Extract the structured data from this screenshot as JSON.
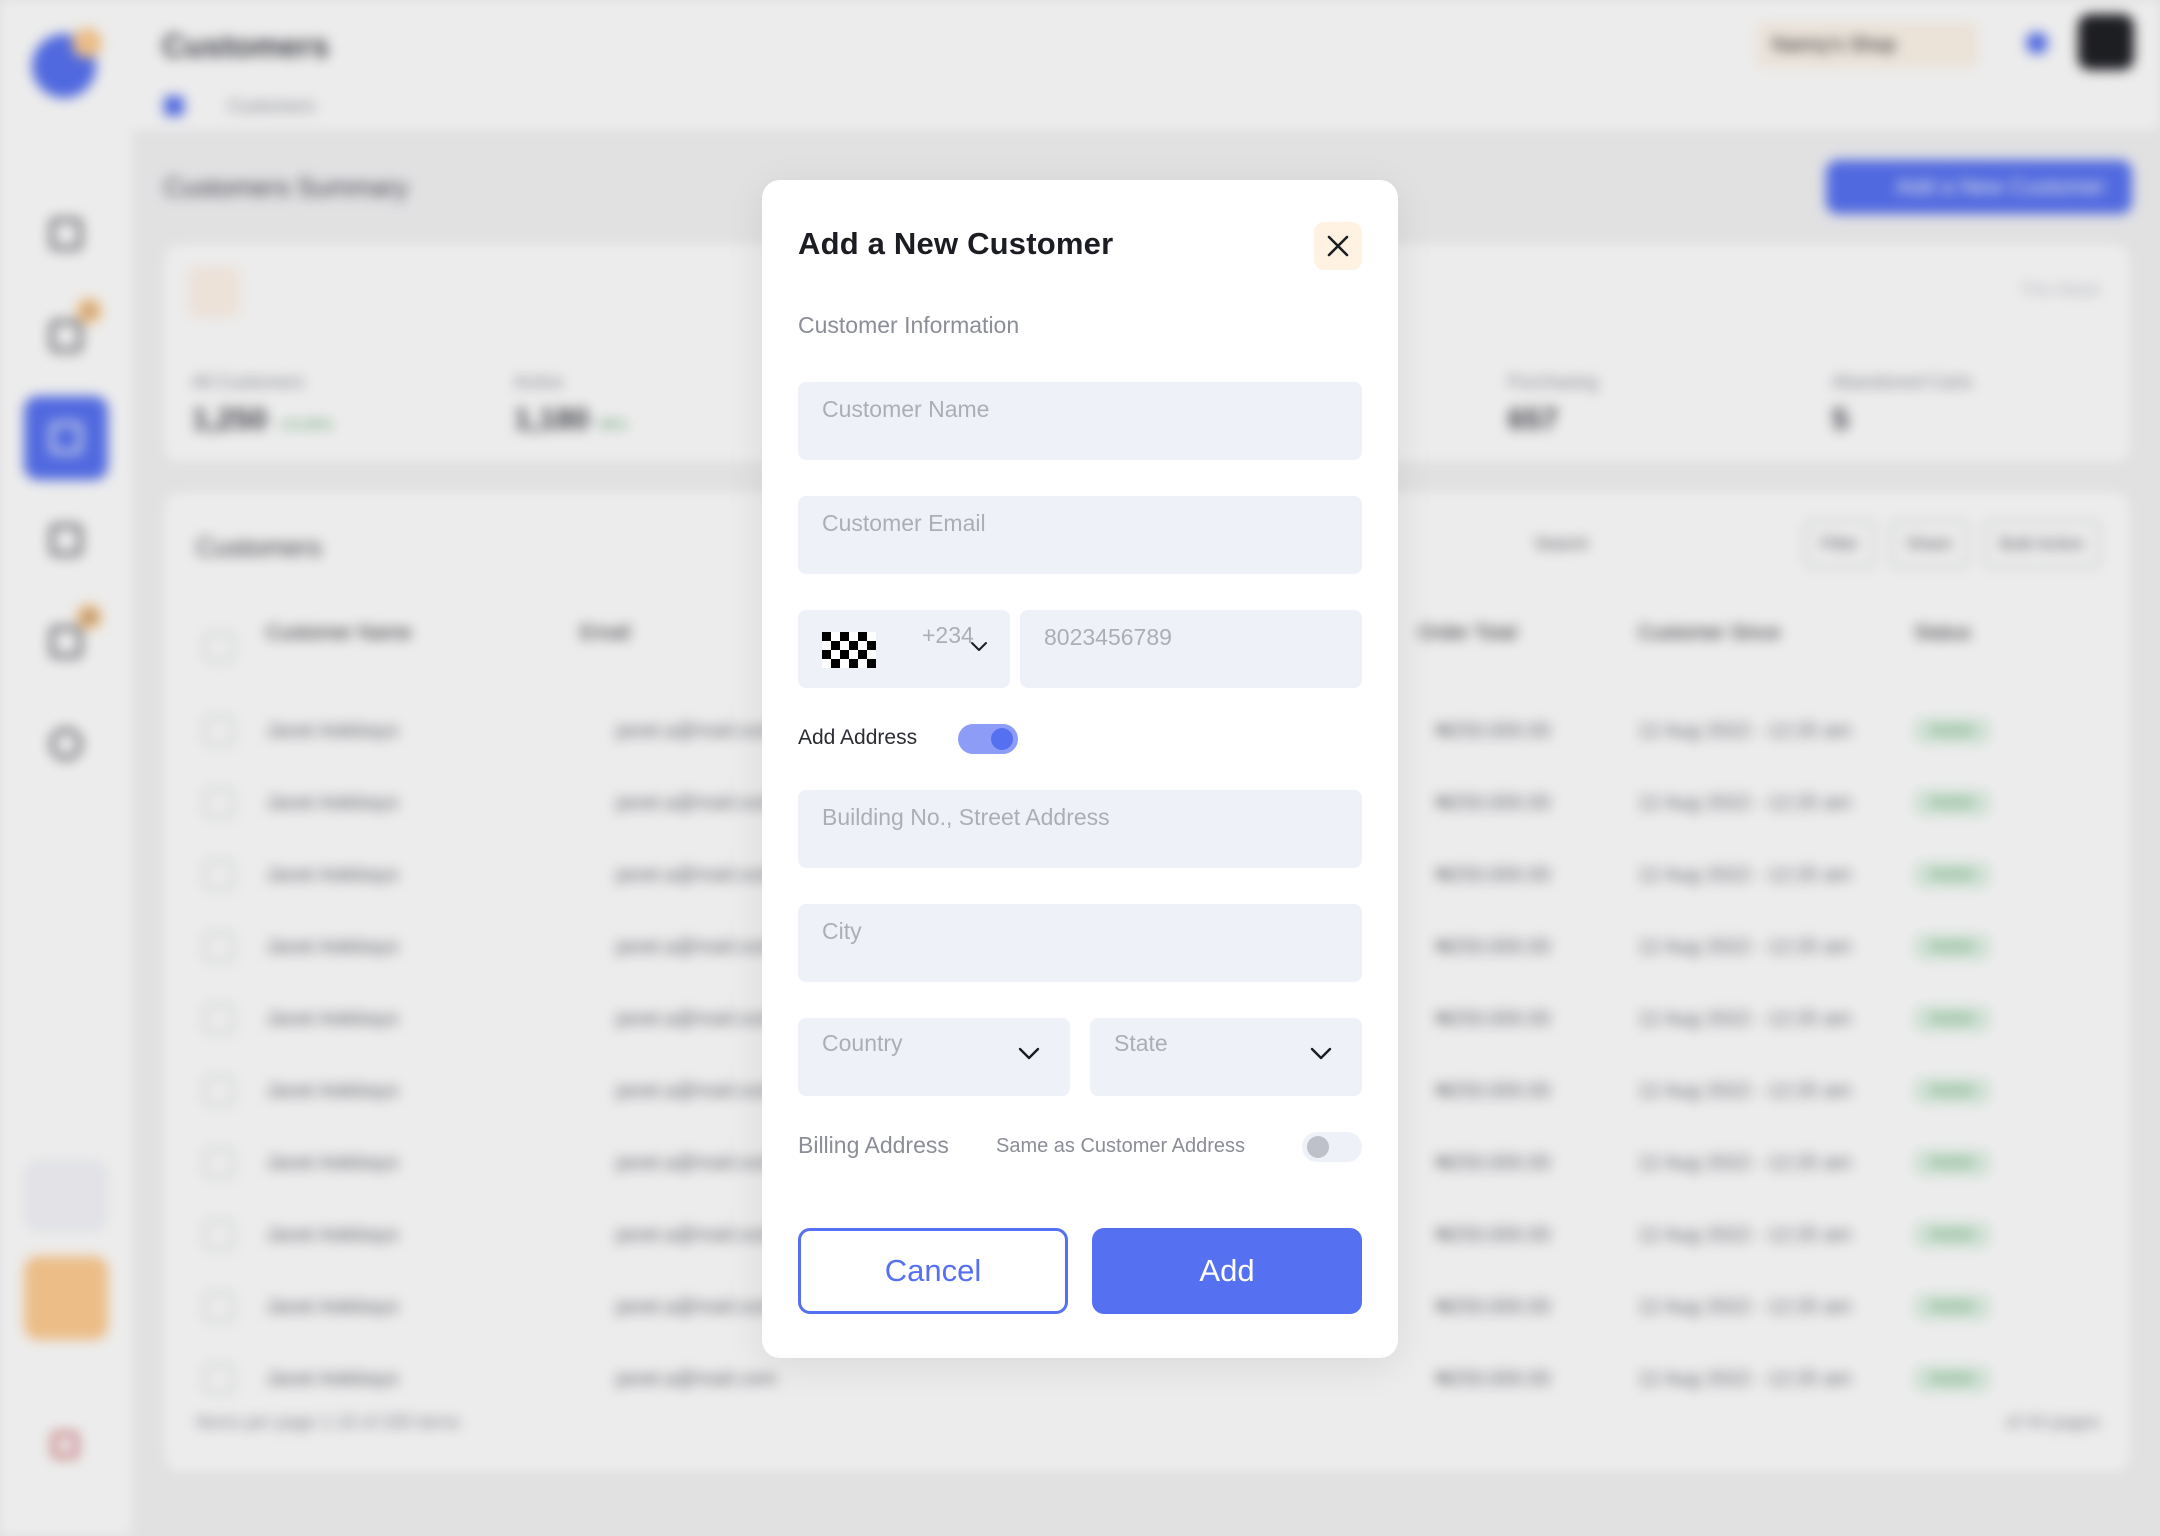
{
  "app": {
    "page_title": "Customers",
    "breadcrumb": "Customers",
    "shop_select": "Nanny's Shop",
    "section_title": "Customers Summary",
    "add_customer_button": "Add a New Customer",
    "summary": {
      "range": "This Week",
      "stats": [
        {
          "label": "All Customers",
          "value": "1,250",
          "delta": "+15.80%"
        },
        {
          "label": "Active",
          "value": "1,180",
          "delta": "85%"
        },
        {
          "label": "Purchasing",
          "value": "657",
          "delta": ""
        },
        {
          "label": "Abandoned Carts",
          "value": "5",
          "delta": ""
        }
      ]
    },
    "table": {
      "title": "Customers",
      "search_placeholder": "Search",
      "filter_label": "Filter",
      "share_label": "Share",
      "bulk_label": "Bulk Action",
      "headers": [
        "Customer Name",
        "Email",
        "Order Total",
        "Customer Since",
        "Status"
      ],
      "rows": [
        {
          "name": "Janet Adebayo",
          "email": "janet.a@mail.com",
          "total": "₦250,000.00",
          "since": "12 Aug 2022 - 12:25 am",
          "status": "Active"
        },
        {
          "name": "Janet Adebayo",
          "email": "janet.a@mail.com",
          "total": "₦250,000.00",
          "since": "12 Aug 2022 - 12:25 am",
          "status": "Active"
        },
        {
          "name": "Janet Adebayo",
          "email": "janet.a@mail.com",
          "total": "₦250,000.00",
          "since": "12 Aug 2022 - 12:25 am",
          "status": "Active"
        },
        {
          "name": "Janet Adebayo",
          "email": "janet.a@mail.com",
          "total": "₦250,000.00",
          "since": "12 Aug 2022 - 12:25 am",
          "status": "Active"
        },
        {
          "name": "Janet Adebayo",
          "email": "janet.a@mail.com",
          "total": "₦250,000.00",
          "since": "12 Aug 2022 - 12:25 am",
          "status": "Active"
        },
        {
          "name": "Janet Adebayo",
          "email": "janet.a@mail.com",
          "total": "₦250,000.00",
          "since": "12 Aug 2022 - 12:25 am",
          "status": "Active"
        },
        {
          "name": "Janet Adebayo",
          "email": "janet.a@mail.com",
          "total": "₦250,000.00",
          "since": "12 Aug 2022 - 12:25 am",
          "status": "Active"
        },
        {
          "name": "Janet Adebayo",
          "email": "janet.a@mail.com",
          "total": "₦250,000.00",
          "since": "12 Aug 2022 - 12:25 am",
          "status": "Active"
        },
        {
          "name": "Janet Adebayo",
          "email": "janet.a@mail.com",
          "total": "₦250,000.00",
          "since": "12 Aug 2022 - 12:25 am",
          "status": "Active"
        },
        {
          "name": "Janet Adebayo",
          "email": "janet.a@mail.com",
          "total": "₦250,000.00",
          "since": "12 Aug 2022 - 12:25 am",
          "status": "Active"
        }
      ],
      "pager_left": "Items per page   1-10 of 200 items",
      "pager_right": "of 44 pages"
    },
    "nav_badges": [
      "3",
      "16"
    ]
  },
  "modal": {
    "title": "Add a New Customer",
    "section": "Customer Information",
    "name_placeholder": "Customer Name",
    "email_placeholder": "Customer Email",
    "phone_code": "+234",
    "phone_placeholder": "8023456789",
    "add_address_label": "Add Address",
    "add_address_on": true,
    "street_placeholder": "Building No., Street Address",
    "city_placeholder": "City",
    "country_placeholder": "Country",
    "state_placeholder": "State",
    "billing_label": "Billing Address",
    "same_as_label": "Same as Customer Address",
    "same_as_on": false,
    "cancel_label": "Cancel",
    "add_label": "Add"
  },
  "colors": {
    "accent": "#5570f1",
    "accent_light": "#8d9df7",
    "close_bg": "#fff2e2",
    "field_bg": "#eff1f9",
    "placeholder": "#abafb1"
  },
  "icons": {
    "close": "close-icon",
    "chevron": "chevron-down-icon",
    "flag": "flag-icon"
  }
}
